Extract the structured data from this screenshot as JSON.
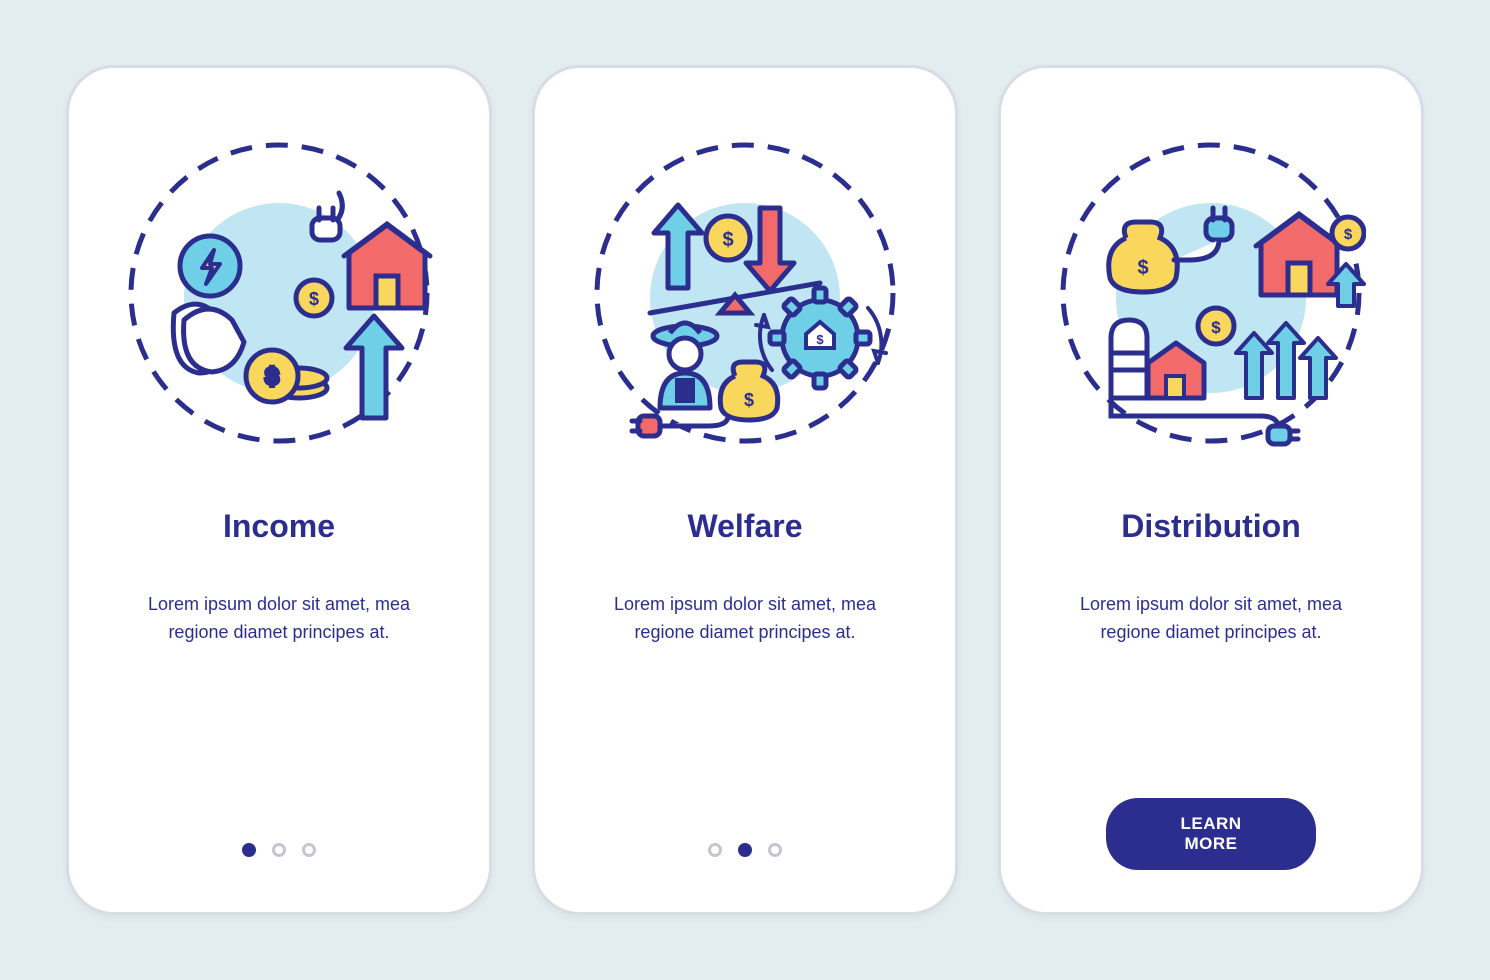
{
  "colors": {
    "primary": "#2c2e8f",
    "accent_red": "#f26a6a",
    "accent_yellow": "#f9d65c",
    "accent_cyan": "#6ecfe6",
    "light_blue": "#bfe6f2",
    "bg": "#e3ecef"
  },
  "screens": [
    {
      "id": "income",
      "title": "Income",
      "description": "Lorem ipsum dolor sit amet, mea regione diamet principes at.",
      "activeDot": 0,
      "hasCta": false,
      "illustration": "income"
    },
    {
      "id": "welfare",
      "title": "Welfare",
      "description": "Lorem ipsum dolor sit amet, mea regione diamet principes at.",
      "activeDot": 1,
      "hasCta": false,
      "illustration": "welfare"
    },
    {
      "id": "distribution",
      "title": "Distribution",
      "description": "Lorem ipsum dolor sit amet, mea regione diamet principes at.",
      "activeDot": 2,
      "hasCta": true,
      "illustration": "distribution"
    }
  ],
  "cta": {
    "label": "LEARN MORE"
  },
  "icons": {
    "income": [
      "hands",
      "bolt-coin",
      "plug",
      "barn",
      "dollar-coin",
      "coins-stack",
      "up-arrow"
    ],
    "welfare": [
      "up-arrow",
      "down-arrow",
      "dollar-coin",
      "seesaw",
      "farmer",
      "money-bag",
      "plug",
      "gear-house-dollar",
      "cycle-arrows"
    ],
    "distribution": [
      "money-bag",
      "plug",
      "barn",
      "dollar-coin",
      "up-arrow",
      "silo",
      "small-barn",
      "wire"
    ]
  }
}
